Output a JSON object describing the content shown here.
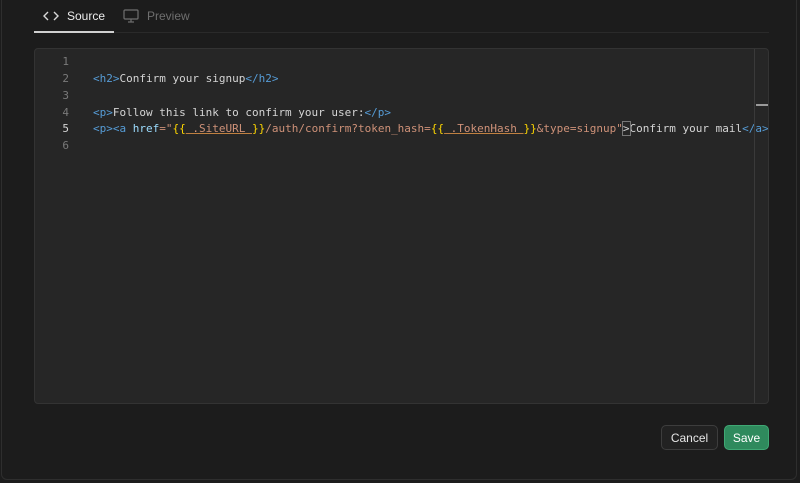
{
  "tabs": {
    "source": {
      "label": "Source",
      "icon": "code-icon"
    },
    "preview": {
      "label": "Preview",
      "icon": "monitor-icon"
    }
  },
  "editor": {
    "line_numbers": [
      "1",
      "2",
      "3",
      "4",
      "5",
      "6"
    ],
    "active_line": "5",
    "line2": {
      "open": "<h2>",
      "text": "Confirm your signup",
      "close": "</h2>"
    },
    "line4": {
      "open": "<p>",
      "text": "Follow this link to confirm your user:",
      "close": "</p>"
    },
    "line5": {
      "p_open": "<p>",
      "a_open": "<a",
      "attr_name": " href",
      "eq_quote": "=\"",
      "brace_open1": "{{",
      "site_url": " .SiteURL ",
      "brace_close1": "}}",
      "path": "/auth/confirm?token_hash=",
      "brace_open2": "{{",
      "token_hash": " .TokenHash ",
      "brace_close2": "}}",
      "type_param": "&type=signup",
      "quote_close": "\"",
      "gt": ">",
      "link_text": "Confirm your mail",
      "a_close": "</a>"
    }
  },
  "actions": {
    "cancel_label": "Cancel",
    "save_label": "Save"
  },
  "colors": {
    "background": "#1c1c1c",
    "editor_bg": "#262626",
    "save_button": "#2f8a5d",
    "tag": "#569cd6",
    "string": "#ce9178",
    "brace": "#ffd700"
  }
}
